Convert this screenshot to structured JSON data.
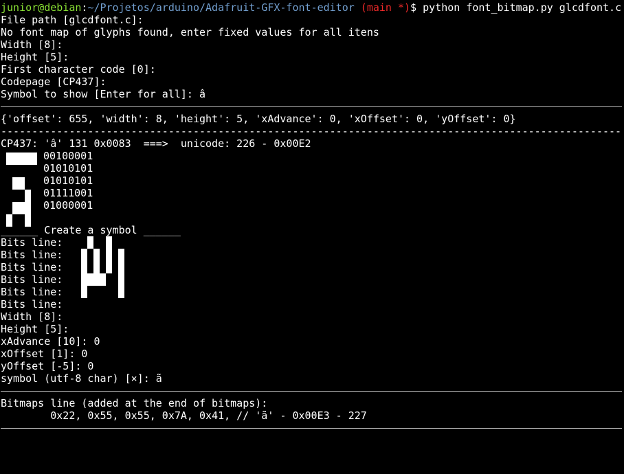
{
  "prompt": {
    "user_host": "junior@debian",
    "separator": ":",
    "path": "~/Projetos/arduino/Adafruit-GFX-font-editor",
    "branch": " (main *)",
    "dollar": "$ ",
    "command": "python font_bitmap.py glcdfont.c"
  },
  "intro_lines": [
    "File path [glcdfont.c]:",
    "No font map of glyphs found, enter fixed values for all itens",
    "Width [8]:",
    "Height [5]:",
    "First character code [0]:",
    "Codepage [CP437]:",
    "Symbol to show [Enter for all]: â"
  ],
  "glyph_info": "{'offset': 655, 'width': 8, 'height': 5, 'xAdvance': 0, 'xOffset': 0, 'yOffset': 0}",
  "dashes": "----------------------------------------------------------------------------------------------------",
  "mapping_line": "CP437: 'â' 131 0x0083  ===>  unicode: 226 - 0x00E2",
  "preview_bits": [
    "00100001",
    "01010101",
    "01010101",
    "01111001",
    "01000001"
  ],
  "create_header": "______ Create a symbol ______",
  "bits_line_label": "Bits line: ",
  "created_rows": [
    "00100100",
    "01010101",
    "01010101",
    "01111001",
    "01000001",
    "00000000"
  ],
  "create_lines": [
    "Width [8]:",
    "Height [5]:",
    "xAdvance [10]: 0",
    "xOffset [1]: 0",
    "yOffset [-5]: 0",
    "symbol (utf-8 char) [×]: ã"
  ],
  "bitmaps_title": "Bitmaps line (added at the end of bitmaps):",
  "bitmaps_line": "        0x22, 0x55, 0x55, 0x7A, 0x41, // 'ã' - 0x00E3 - 227",
  "colors": {
    "background": "#000000",
    "foreground": "#ffffff",
    "user_host": "#8ae234",
    "path": "#729fcf",
    "branch": "#ef2929"
  }
}
